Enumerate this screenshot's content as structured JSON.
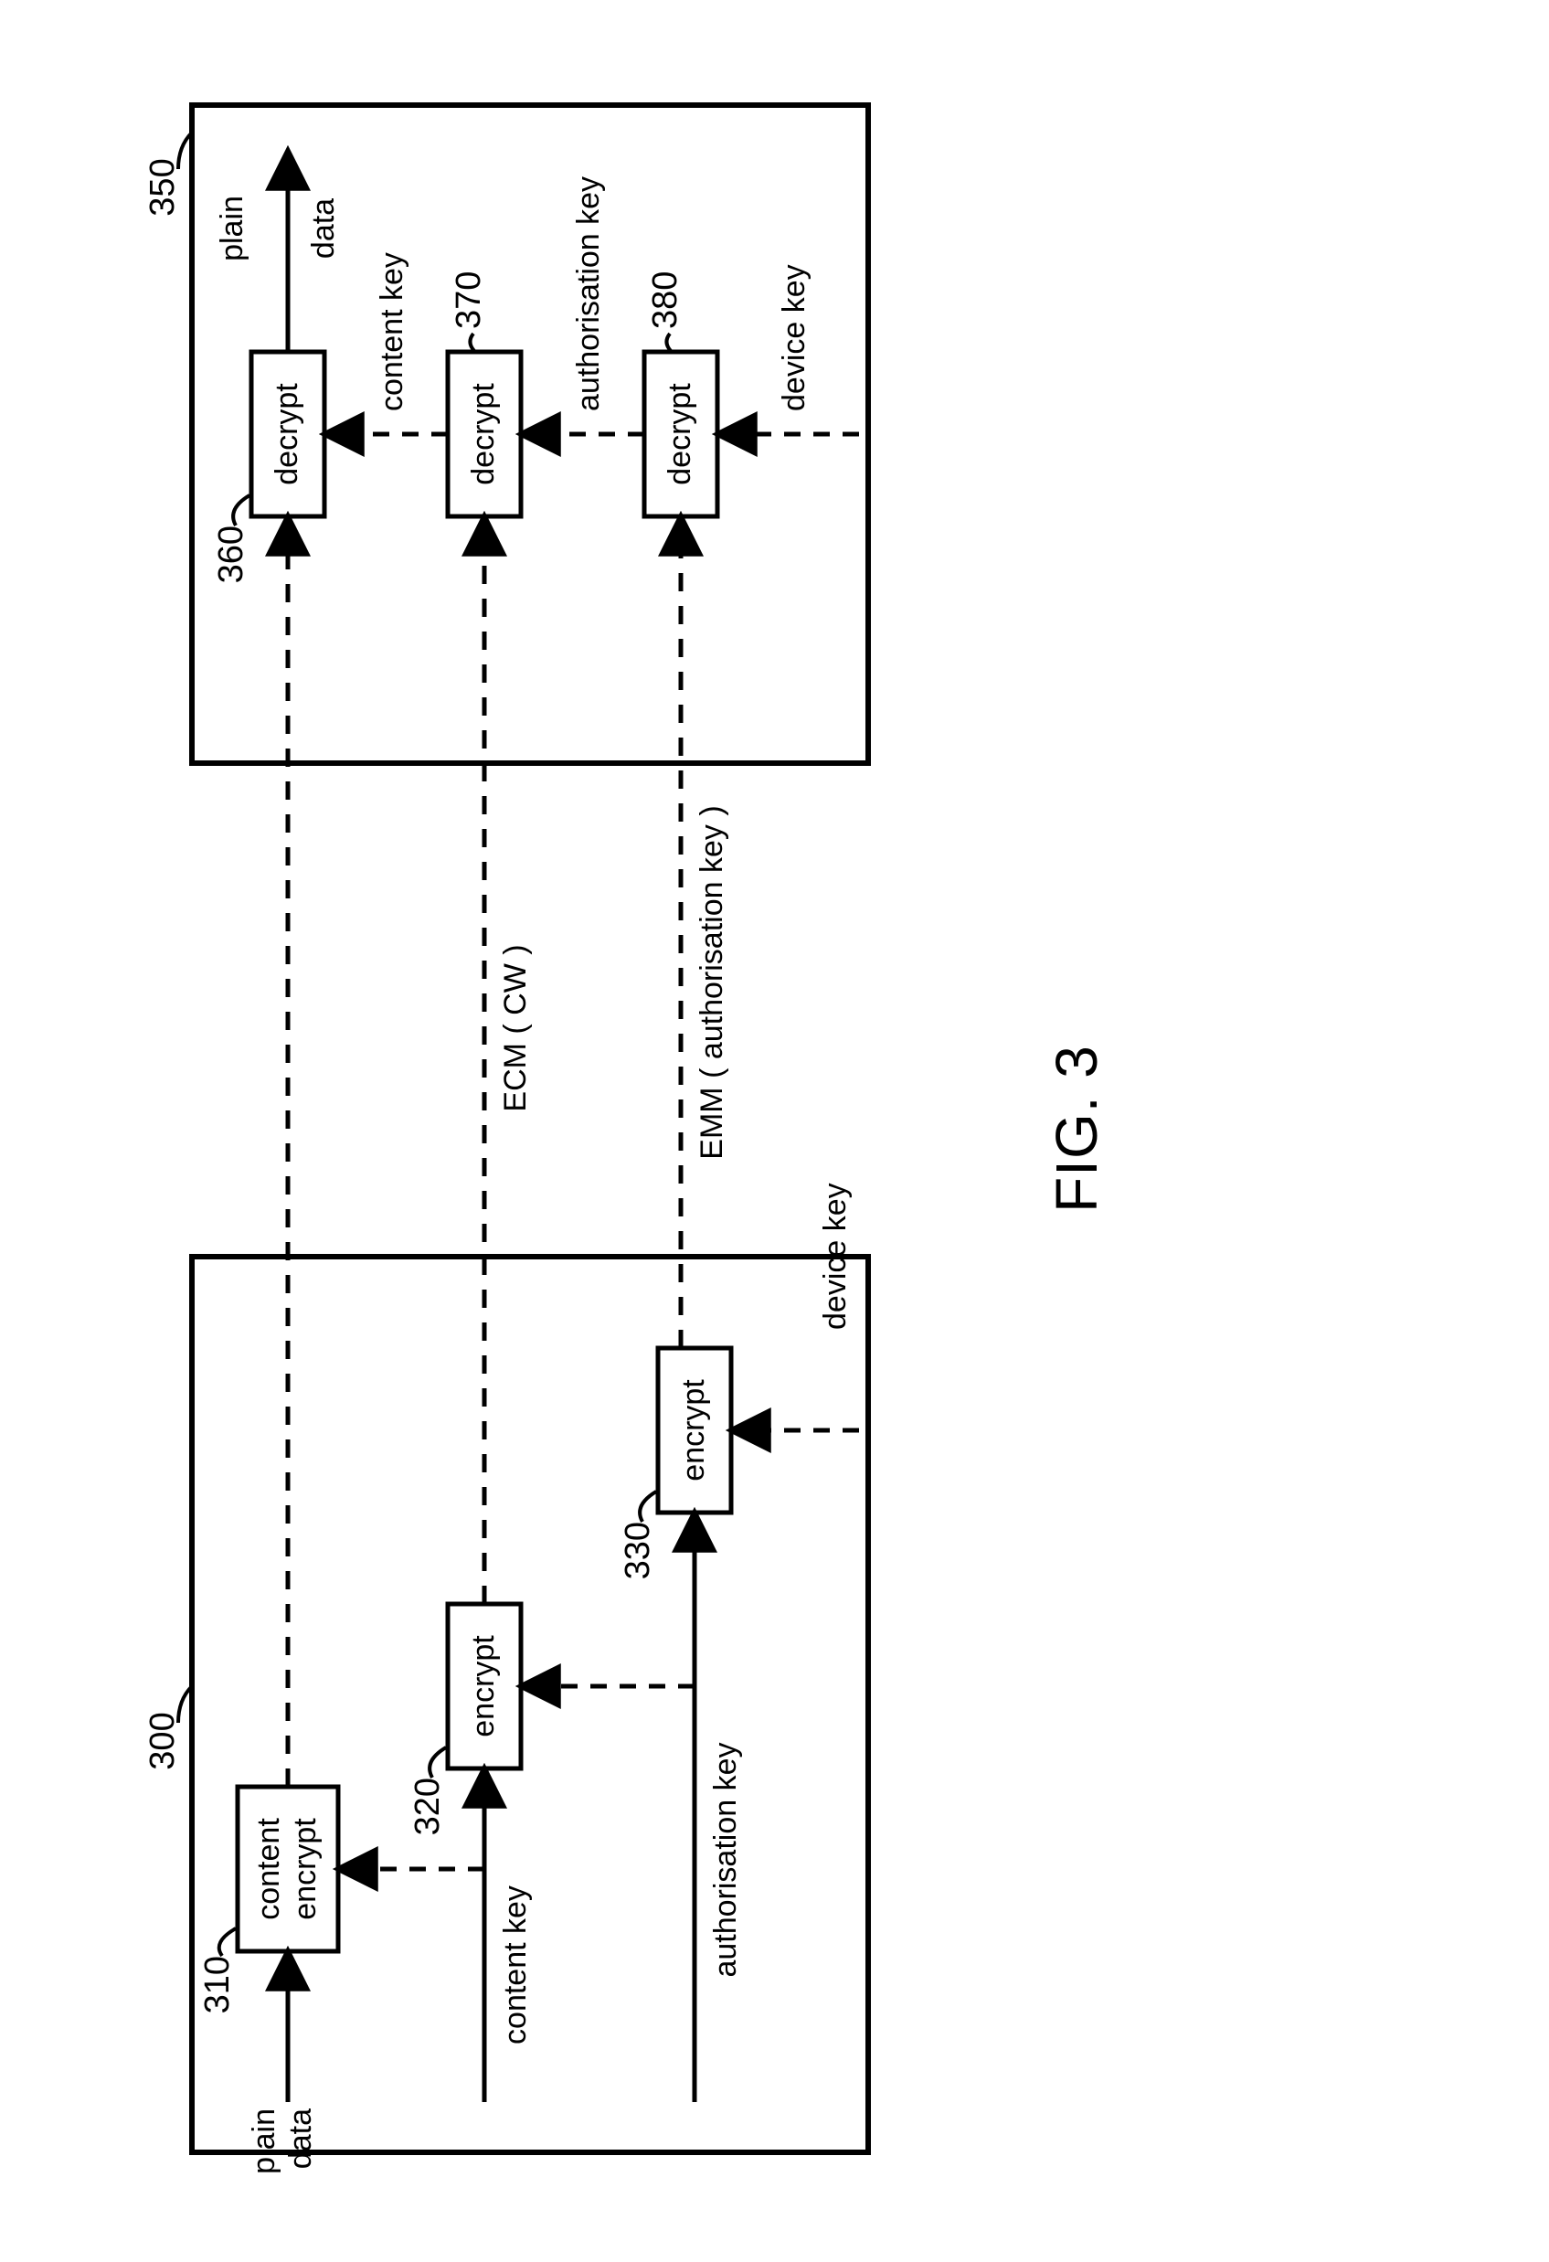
{
  "figure_label": "FIG. 3",
  "left": {
    "ref": "300",
    "blocks": {
      "b310": {
        "ref": "310",
        "line1": "content",
        "line2": "encrypt"
      },
      "b320": {
        "ref": "320",
        "label": "encrypt"
      },
      "b330": {
        "ref": "330",
        "label": "encrypt"
      }
    },
    "inputs": {
      "plain": "plain",
      "data": "data",
      "content_key": "content key",
      "authorisation_key": "authorisation key",
      "device_key": "device key"
    }
  },
  "right": {
    "ref": "350",
    "blocks": {
      "b360": {
        "ref": "360",
        "label": "decrypt"
      },
      "b370": {
        "ref": "370",
        "label": "decrypt"
      },
      "b380": {
        "ref": "380",
        "label": "decrypt"
      }
    },
    "outputs": {
      "plain": "plain",
      "data": "data"
    },
    "keys": {
      "content_key": "content key",
      "authorisation_key": "authorisation key",
      "device_key": "device key"
    }
  },
  "links": {
    "ecm": "ECM ( CW )",
    "emm": "EMM ( authorisation key )"
  }
}
